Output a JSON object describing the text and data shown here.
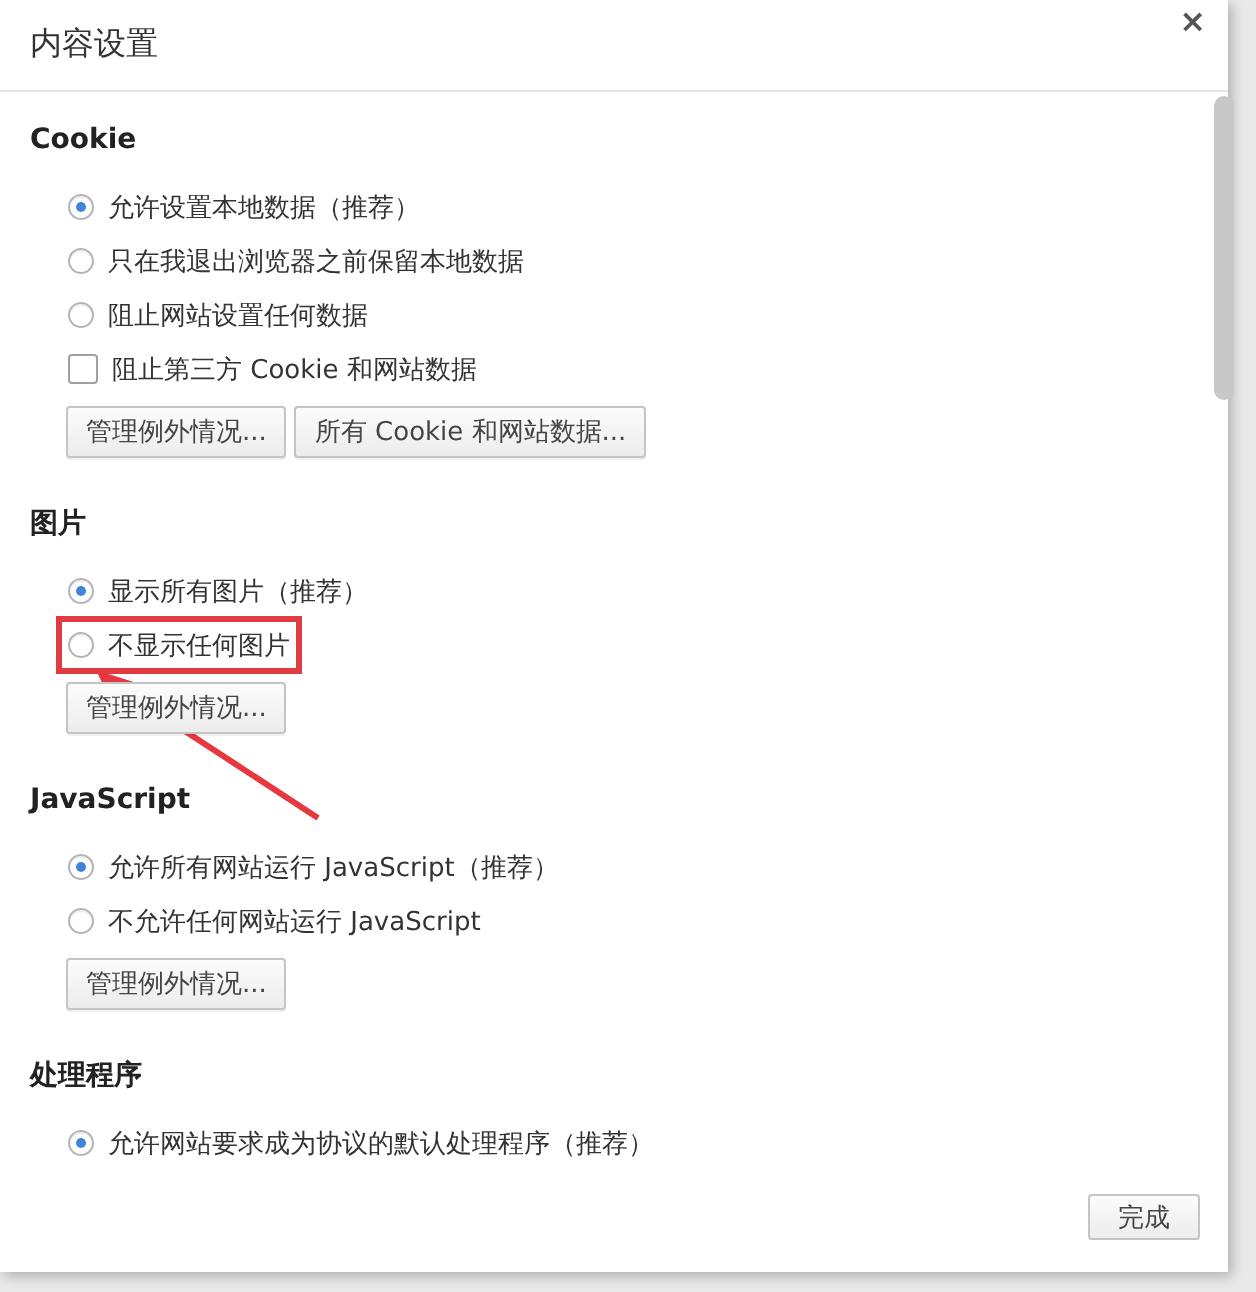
{
  "window": {
    "title": "内容设置",
    "close": "×"
  },
  "sections": [
    {
      "heading": "Cookie",
      "options": [
        {
          "kind": "radio",
          "label": "允许设置本地数据（推荐）",
          "selected": true,
          "highlighted": false
        },
        {
          "kind": "radio",
          "label": "只在我退出浏览器之前保留本地数据",
          "selected": false,
          "highlighted": false
        },
        {
          "kind": "radio",
          "label": "阻止网站设置任何数据",
          "selected": false,
          "highlighted": false
        },
        {
          "kind": "checkbox",
          "label": "阻止第三方 Cookie 和网站数据",
          "checked": false,
          "highlighted": false
        }
      ],
      "buttons": [
        "管理例外情况...",
        "所有 Cookie 和网站数据..."
      ]
    },
    {
      "heading": "图片",
      "options": [
        {
          "kind": "radio",
          "label": "显示所有图片（推荐）",
          "selected": true,
          "highlighted": false
        },
        {
          "kind": "radio",
          "label": "不显示任何图片",
          "selected": false,
          "highlighted": true
        }
      ],
      "buttons": [
        "管理例外情况..."
      ]
    },
    {
      "heading": "JavaScript",
      "options": [
        {
          "kind": "radio",
          "label": "允许所有网站运行 JavaScript（推荐）",
          "selected": true,
          "highlighted": false
        },
        {
          "kind": "radio",
          "label": "不允许任何网站运行 JavaScript",
          "selected": false,
          "highlighted": false
        }
      ],
      "buttons": [
        "管理例外情况..."
      ]
    },
    {
      "heading": "处理程序",
      "options": [
        {
          "kind": "radio",
          "label": "允许网站要求成为协议的默认处理程序（推荐）",
          "selected": true,
          "highlighted": false
        }
      ]
    }
  ],
  "footer": {
    "button": "完成"
  }
}
